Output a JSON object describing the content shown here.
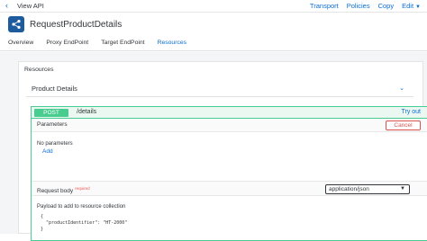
{
  "topbar": {
    "back_label": "View API",
    "actions": [
      "Transport",
      "Policies",
      "Copy",
      "Edit"
    ]
  },
  "header": {
    "title": "RequestProductDetails",
    "icon": "share-icon",
    "tabs": [
      "Overview",
      "Proxy EndPoint",
      "Target EndPoint",
      "Resources"
    ],
    "active_tab": "Resources"
  },
  "resources": {
    "label": "Resources",
    "group_title": "Product Details",
    "operation": {
      "method": "POST",
      "path": "/details",
      "try_out_label": "Try out",
      "parameters_label": "Parameters",
      "cancel_label": "Cancel",
      "no_parameters_text": "No parameters",
      "add_label": "Add",
      "request_body_label": "Request body",
      "required_label": "required",
      "content_type": "application/json",
      "payload_description": "Payload to add to resource collection",
      "payload_line1": "{",
      "payload_line2": "  \"productIdentifier\": \"HT-2000\"",
      "payload_line3": "}"
    }
  },
  "colors": {
    "accent": "#0a6ed1",
    "post_green": "#49cc90",
    "cancel_red": "#d9534f"
  }
}
